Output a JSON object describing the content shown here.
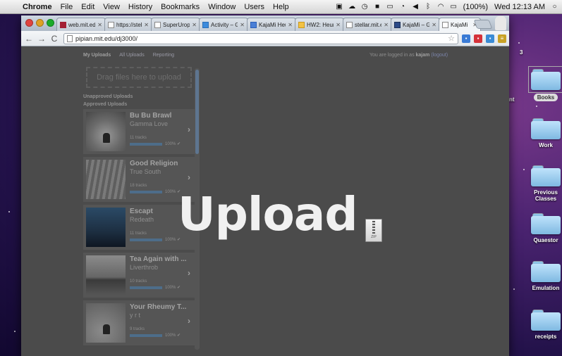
{
  "menubar": {
    "app": "Chrome",
    "items": [
      "File",
      "Edit",
      "View",
      "History",
      "Bookmarks",
      "Window",
      "Users",
      "Help"
    ],
    "battery": "(100%)",
    "clock": "Wed 12:13 AM"
  },
  "desktop": {
    "folders": [
      "Books",
      "Work",
      "Previous Classes",
      "Quaestor",
      "Emulation",
      "receipts"
    ],
    "edge_labels": [
      "nt",
      "3"
    ]
  },
  "browser": {
    "tabs": [
      {
        "label": "web.mit.edu",
        "favicon": "mit-favicon"
      },
      {
        "label": "https://stell",
        "favicon": "page-favicon"
      },
      {
        "label": "SuperUrops",
        "favicon": "page-favicon"
      },
      {
        "label": "Activity – Go",
        "favicon": "drive-favicon"
      },
      {
        "label": "KajaMi Heur",
        "favicon": "doc-favicon"
      },
      {
        "label": "HW2: Heurist",
        "favicon": "doc-favicon"
      },
      {
        "label": "stellar.mit.e",
        "favicon": "page-favicon"
      },
      {
        "label": "KajaMi – Gith",
        "favicon": "github-favicon"
      },
      {
        "label": "KajaMi",
        "favicon": "page-favicon"
      }
    ],
    "url": "pipian.mit.edu/dj3000/"
  },
  "page": {
    "nav": [
      "My Uploads",
      "All Uploads",
      "Reporting"
    ],
    "logged_in_prefix": "You are logged in as ",
    "username": "kajam",
    "logout": "(logout)",
    "dropzone": "Drag files here to upload",
    "unapproved_label": "Unapproved Uploads",
    "approved_label": "Approved Uploads",
    "albums": [
      {
        "title": "Bu Bu Brawl",
        "artist": "Gamma Love",
        "tracks": "11 tracks",
        "progress": 100,
        "pct": "100% ✔"
      },
      {
        "title": "Good Religion",
        "artist": "True South",
        "tracks": "18 tracks",
        "progress": 100,
        "pct": "100% ✔"
      },
      {
        "title": "Escapt",
        "artist": "Redeath",
        "tracks": "11 tracks",
        "progress": 100,
        "pct": "100% ✔"
      },
      {
        "title": "Tea Again with ...",
        "artist": "Liverthrob",
        "tracks": "10 tracks",
        "progress": 100,
        "pct": "100% ✔"
      },
      {
        "title": "Your Rheumy T...",
        "artist": "y r t",
        "tracks": "9 tracks",
        "progress": 100,
        "pct": "100% ✔"
      }
    ]
  },
  "overlay": {
    "title": "Upload",
    "file_label": "ZIP"
  }
}
